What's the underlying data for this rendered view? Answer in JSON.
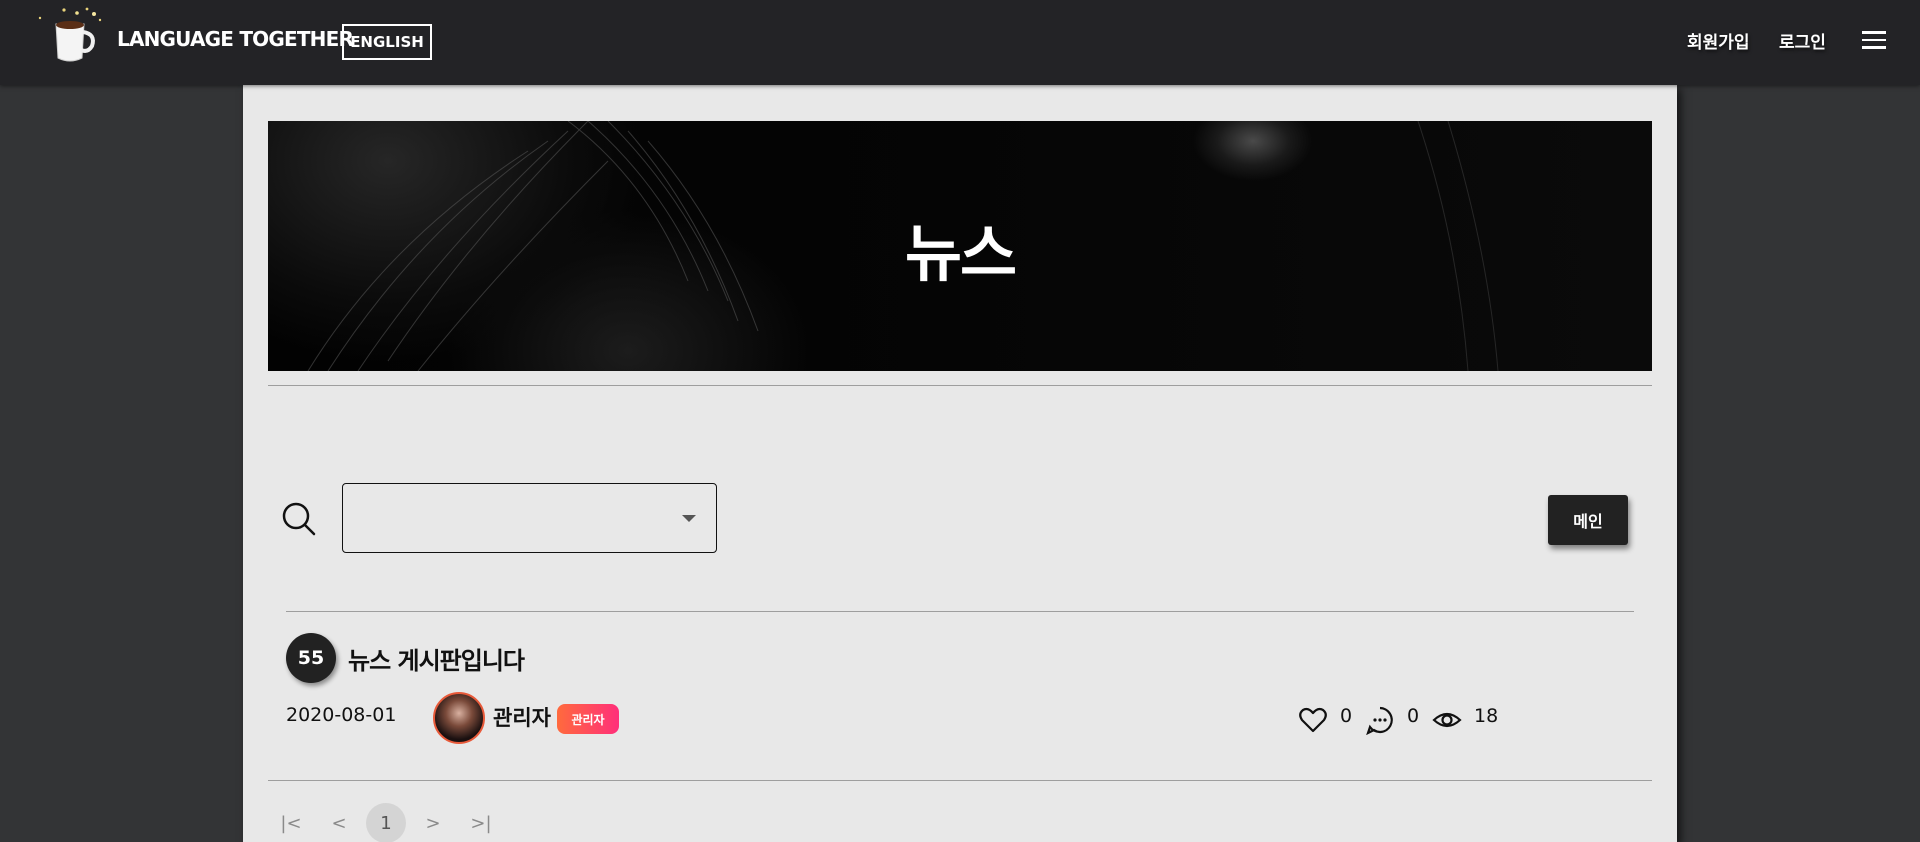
{
  "header": {
    "logo_text": "LANGUAGE TOGETHER",
    "lang_button": "ENGLISH",
    "signup": "회원가입",
    "login": "로그인"
  },
  "hero": {
    "title": "뉴스"
  },
  "toolbar": {
    "select_value": "",
    "main_button": "메인"
  },
  "posts": [
    {
      "number": "55",
      "title": "뉴스 게시판입니다",
      "date": "2020-08-01",
      "author": "관리자",
      "badge": "관리자",
      "likes": "0",
      "comments": "0",
      "views": "18"
    }
  ],
  "pagination": {
    "first": "|<",
    "prev": "<",
    "current": "1",
    "next": ">",
    "last": ">|"
  },
  "colors": {
    "page_bg": "#333436",
    "header_bg": "#232326",
    "panel_bg": "#e8e8e8",
    "badge_from": "#ff6a3d",
    "badge_to": "#ff2f7a"
  },
  "icons": {
    "logo": "coffee-cup-icon",
    "menu": "hamburger-menu-icon",
    "search": "search-icon",
    "likes": "heart-icon",
    "comments": "comment-icon",
    "views": "eye-icon"
  }
}
